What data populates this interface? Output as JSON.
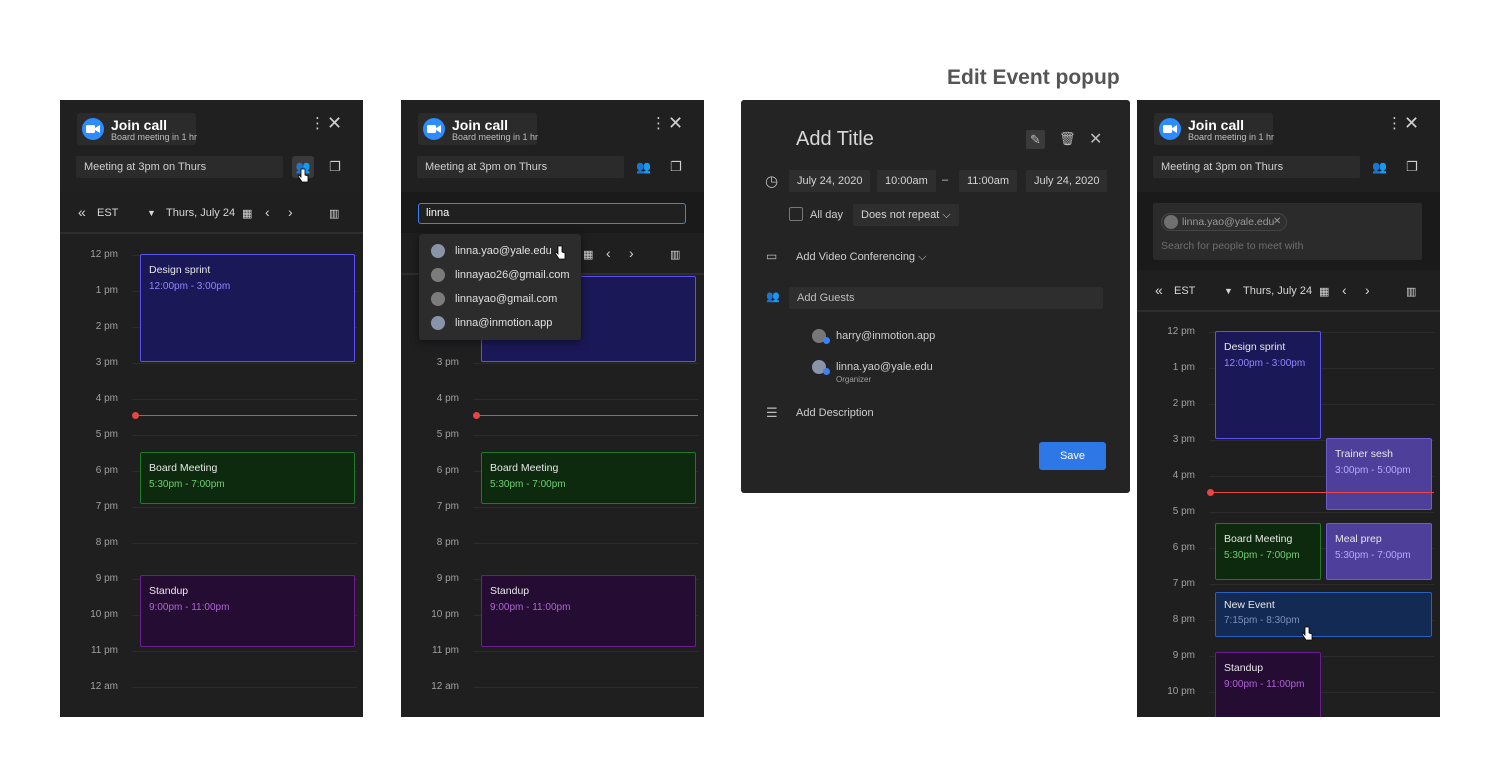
{
  "heading": "Edit Event popup",
  "join": {
    "title": "Join call",
    "subtitle": "Board meeting in 1 hr"
  },
  "meeting_box": "Meeting at 3pm on Thurs",
  "toolbar": {
    "tz": "EST",
    "date": "Thurs, July 24"
  },
  "hours": [
    "12 pm",
    "1 pm",
    "2 pm",
    "3 pm",
    "4 pm",
    "5 pm",
    "6 pm",
    "7 pm",
    "8 pm",
    "9 pm",
    "10 pm",
    "11 pm",
    "12 am"
  ],
  "events": {
    "design": {
      "name": "Design sprint",
      "time": "12:00pm - 3:00pm"
    },
    "board": {
      "name": "Board Meeting",
      "time": "5:30pm - 7:00pm"
    },
    "standup": {
      "name": "Standup",
      "time": "9:00pm - 11:00pm"
    },
    "trainer": {
      "name": "Trainer sesh",
      "time": "3:00pm - 5:00pm"
    },
    "meal": {
      "name": "Meal prep",
      "time": "5:30pm - 7:00pm"
    },
    "newev": {
      "name": "New Event",
      "time": "7:15pm - 8:30pm"
    }
  },
  "search": {
    "value": "linna",
    "results": [
      "linna.yao@yale.edu",
      "linnayao26@gmail.com",
      "linnayao@gmail.com",
      "linna@inmotion.app"
    ]
  },
  "popup": {
    "title": "Add Title",
    "start_date": "July 24, 2020",
    "start_time": "10:00am",
    "dash": "–",
    "end_time": "11:00am",
    "end_date": "July 24, 2020",
    "all_day": "All day",
    "repeat": "Does not repeat",
    "video": "Add Video Conferencing",
    "guests_placeholder": "Add Guests",
    "guest1": "harry@inmotion.app",
    "guest2": "linna.yao@yale.edu",
    "guest2_role": "Organizer",
    "description": "Add Description",
    "save": "Save"
  },
  "chip": {
    "email": "linna.yao@yale.edu",
    "placeholder": "Search for people to meet with"
  },
  "colors": {
    "design": "#1b1857",
    "design_border": "#5b53f0",
    "board": "#0d2a0f",
    "board_border": "#1f7a2a",
    "standup": "#250c33",
    "standup_border": "#6b1f8e",
    "trainer": "#4d3f9a",
    "newev": "#132a55",
    "now": "#e84545",
    "accent": "#2d77e6"
  }
}
